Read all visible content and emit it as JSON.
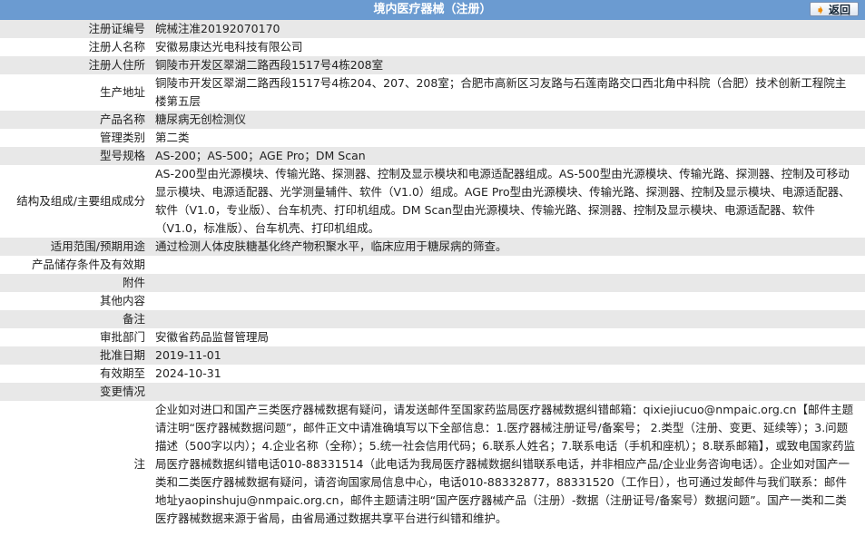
{
  "header": {
    "title": "境内医疗器械（注册）",
    "back_label": "返回"
  },
  "rows": [
    {
      "label": "注册证编号",
      "value": "皖械注准20192070170"
    },
    {
      "label": "注册人名称",
      "value": "安徽易康达光电科技有限公司"
    },
    {
      "label": "注册人住所",
      "value": "铜陵市开发区翠湖二路西段1517号4栋208室"
    },
    {
      "label": "生产地址",
      "value": "铜陵市开发区翠湖二路西段1517号4栋204、207、208室；合肥市高新区习友路与石莲南路交口西北角中科院（合肥）技术创新工程院主楼第五层"
    },
    {
      "label": "产品名称",
      "value": "糖尿病无创检测仪"
    },
    {
      "label": "管理类别",
      "value": "第二类"
    },
    {
      "label": "型号规格",
      "value": "AS-200；AS-500；AGE Pro；DM Scan"
    },
    {
      "label": "结构及组成/主要组成成分",
      "value": "AS-200型由光源模块、传输光路、探测器、控制及显示模块和电源适配器组成。AS-500型由光源模块、传输光路、探测器、控制及可移动显示模块、电源适配器、光学测量辅件、软件（V1.0）组成。AGE Pro型由光源模块、传输光路、探测器、控制及显示模块、电源适配器、软件（V1.0，专业版）、台车机壳、打印机组成。DM Scan型由光源模块、传输光路、探测器、控制及显示模块、电源适配器、软件（V1.0，标准版）、台车机壳、打印机组成。"
    },
    {
      "label": "适用范围/预期用途",
      "value": "通过检测人体皮肤糖基化终产物积聚水平，临床应用于糖尿病的筛查。"
    },
    {
      "label": "产品储存条件及有效期",
      "value": ""
    },
    {
      "label": "附件",
      "value": ""
    },
    {
      "label": "其他内容",
      "value": ""
    },
    {
      "label": "备注",
      "value": ""
    },
    {
      "label": "审批部门",
      "value": "安徽省药品监督管理局"
    },
    {
      "label": "批准日期",
      "value": "2019-11-01"
    },
    {
      "label": "有效期至",
      "value": "2024-10-31"
    },
    {
      "label": "变更情况",
      "value": ""
    },
    {
      "label": "注",
      "value": "企业如对进口和国产三类医疗器械数据有疑问，请发送邮件至国家药监局医疗器械数据纠错邮箱：qixiejiucuo@nmpaic.org.cn【邮件主题请注明“医疗器械数据问题”，邮件正文中请准确填写以下全部信息：1.医疗器械注册证号/备案号； 2.类型（注册、变更、延续等）；3.问题描述（500字以内）；4.企业名称（全称）；5.统一社会信用代码；6.联系人姓名；7.联系电话（手机和座机）；8.联系邮箱】，或致电国家药监局医疗器械数据纠错电话010-88331514（此电话为我局医疗器械数据纠错联系电话，并非相应产品/企业业务咨询电话）。企业如对国产一类和二类医疗器械数据有疑问，请咨询国家局信息中心，电话010-88332877，88331520（工作日），也可通过发邮件与我们联系：邮件地址yaopinshuju@nmpaic.org.cn，邮件主题请注明“国产医疗器械产品（注册）-数据（注册证号/备案号）数据问题”。国产一类和二类医疗器械数据来源于省局，由省局通过数据共享平台进行纠错和维护。"
    }
  ]
}
